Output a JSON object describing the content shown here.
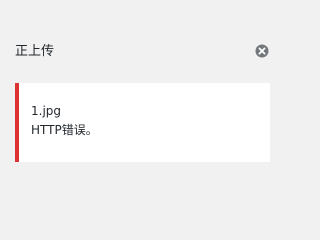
{
  "header": {
    "title": "正上传",
    "close_icon": "close-circle-icon"
  },
  "upload_error": {
    "file_name": "1.jpg",
    "message": "HTTP错误。",
    "accent_color": "#dc3232"
  },
  "colors": {
    "background": "#f1f1f1",
    "card_background": "#ffffff",
    "text": "#23282d",
    "icon": "#72777c"
  }
}
